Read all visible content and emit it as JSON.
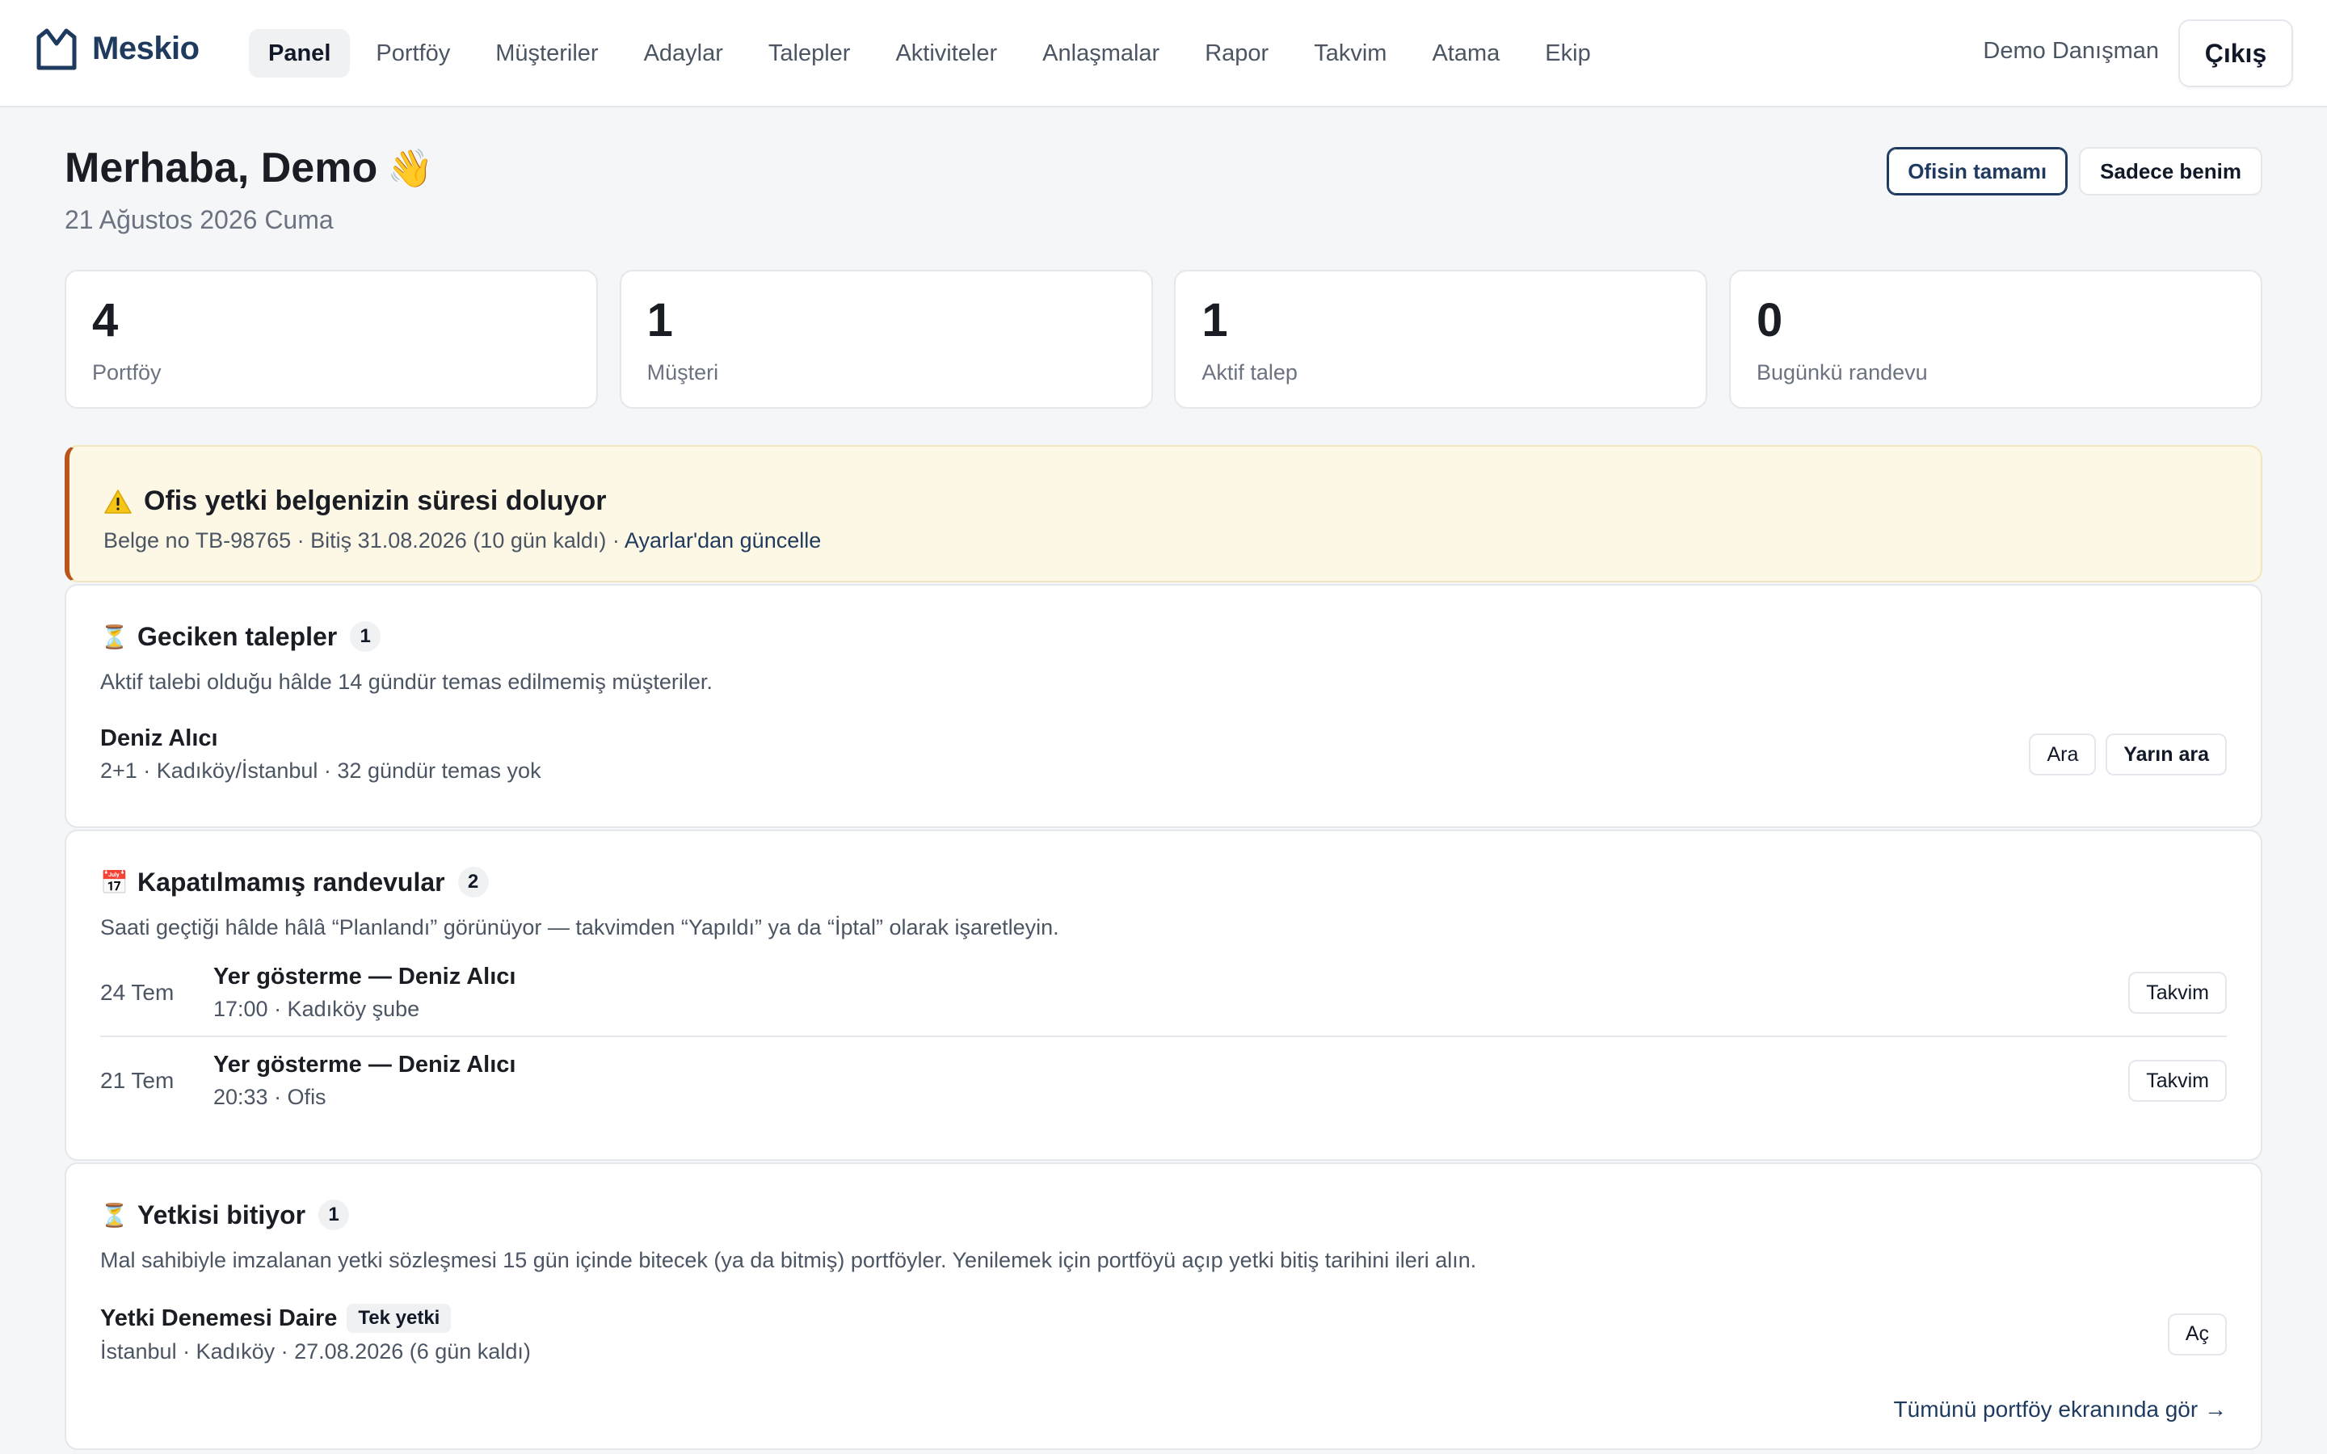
{
  "app": {
    "name": "Meskio",
    "user": "Demo Danışman",
    "logout_label": "Çıkış"
  },
  "nav": {
    "items": [
      {
        "label": "Panel",
        "active": true
      },
      {
        "label": "Portföy"
      },
      {
        "label": "Müşteriler"
      },
      {
        "label": "Adaylar"
      },
      {
        "label": "Talepler"
      },
      {
        "label": "Aktiviteler"
      },
      {
        "label": "Anlaşmalar"
      },
      {
        "label": "Rapor"
      },
      {
        "label": "Takvim"
      },
      {
        "label": "Atama"
      },
      {
        "label": "Ekip"
      }
    ]
  },
  "greeting": {
    "title": "Merhaba, Demo",
    "emoji": "👋",
    "date": "21 Ağustos 2026 Cuma"
  },
  "scope": {
    "office_label": "Ofisin tamamı",
    "mine_label": "Sadece benim",
    "selected": "office"
  },
  "stats": [
    {
      "value": "4",
      "label": "Portföy"
    },
    {
      "value": "1",
      "label": "Müşteri"
    },
    {
      "value": "1",
      "label": "Aktif talep"
    },
    {
      "value": "0",
      "label": "Bugünkü randevu"
    }
  ],
  "alert": {
    "title": "Ofis yetki belgenizin süresi doluyor",
    "body": "Belge no TB-98765 · Bitiş 31.08.2026 (10 gün kaldı) · ",
    "link": "Ayarlar'dan güncelle",
    "icon": "warning-icon",
    "accent_color": "#b8561b",
    "background_color": "#fdf8e6"
  },
  "overdue": {
    "icon": "⏳",
    "title": "Geciken talepler",
    "count": "1",
    "description": "Aktif talebi olduğu hâlde 14 gündür temas edilmemiş müşteriler.",
    "rows": [
      {
        "name": "Deniz Alıcı",
        "detail": "2+1 · Kadıköy/İstanbul · 32 gündür temas yok",
        "call_label": "Ara",
        "call_tomorrow_label": "Yarın ara"
      }
    ]
  },
  "appointments": {
    "icon": "📅",
    "title": "Kapatılmamış randevular",
    "count": "2",
    "description": "Saati geçtiği hâlde hâlâ “Planlandı” görünüyor — takvimden “Yapıldı” ya da “İptal” olarak işaretleyin.",
    "rows": [
      {
        "date": "24 Tem",
        "title": "Yer gösterme — Deniz Alıcı",
        "detail": "17:00 · Kadıköy şube",
        "button": "Takvim"
      },
      {
        "date": "21 Tem",
        "title": "Yer gösterme — Deniz Alıcı",
        "detail": "20:33 · Ofis",
        "button": "Takvim"
      }
    ]
  },
  "authority": {
    "icon": "⏳",
    "title": "Yetkisi bitiyor",
    "count": "1",
    "description": "Mal sahibiyle imzalanan yetki sözleşmesi 15 gün içinde bitecek (ya da bitmiş) portföyler. Yenilemek için portföyü açıp yetki bitiş tarihini ileri alın.",
    "rows": [
      {
        "title": "Yetki Denemesi Daire",
        "tag": "Tek yetki",
        "detail": "İstanbul · Kadıköy · 27.08.2026 (6 gün kaldı)",
        "button": "Aç"
      }
    ],
    "see_all": "Tümünü portföy ekranında gör →"
  }
}
